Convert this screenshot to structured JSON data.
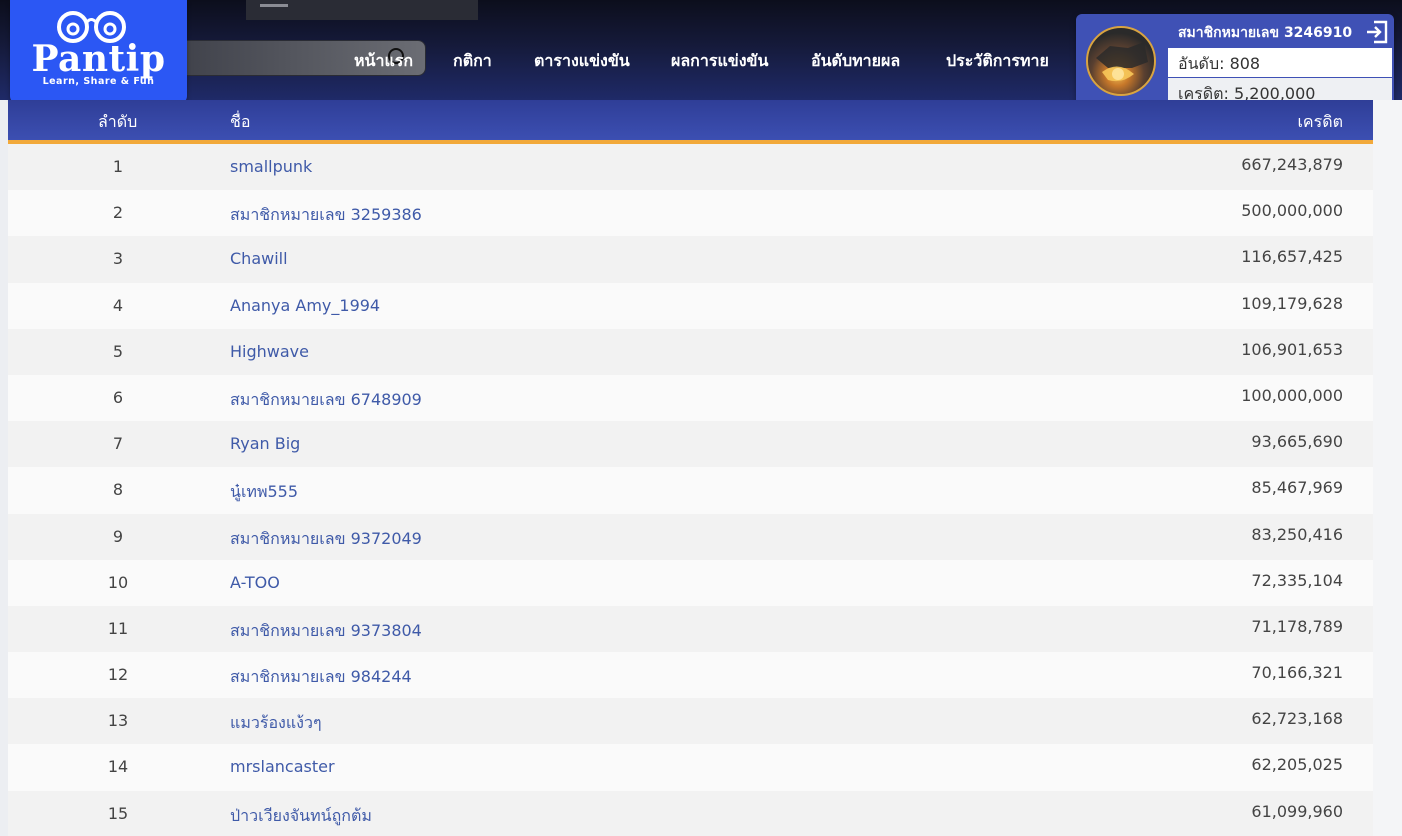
{
  "logo": {
    "text": "Pantip",
    "tagline": "Learn, Share & Fun"
  },
  "nav": [
    {
      "label": "หน้าแรก"
    },
    {
      "label": "กติกา"
    },
    {
      "label": "ตารางแข่งขัน"
    },
    {
      "label": "ผลการแข่งขัน"
    },
    {
      "label": "อันดับทายผล"
    },
    {
      "label": "ประวัติการทาย"
    }
  ],
  "user": {
    "name": "สมาชิกหมายเลข 3246910",
    "rank": "อันดับ: 808",
    "credit": "เครดิต: 5,200,000"
  },
  "table": {
    "headers": {
      "rank": "ลำดับ",
      "name": "ชื่อ",
      "credit": "เครดิต"
    },
    "rows": [
      {
        "rank": "1",
        "name": "smallpunk",
        "credit": "667,243,879"
      },
      {
        "rank": "2",
        "name": "สมาชิกหมายเลข 3259386",
        "credit": "500,000,000"
      },
      {
        "rank": "3",
        "name": "Chawill",
        "credit": "116,657,425"
      },
      {
        "rank": "4",
        "name": "Ananya Amy_1994",
        "credit": "109,179,628"
      },
      {
        "rank": "5",
        "name": "Highwave",
        "credit": "106,901,653"
      },
      {
        "rank": "6",
        "name": "สมาชิกหมายเลข 6748909",
        "credit": "100,000,000"
      },
      {
        "rank": "7",
        "name": "Ryan Big",
        "credit": "93,665,690"
      },
      {
        "rank": "8",
        "name": "นู๋เทพ555",
        "credit": "85,467,969"
      },
      {
        "rank": "9",
        "name": "สมาชิกหมายเลข 9372049",
        "credit": "83,250,416"
      },
      {
        "rank": "10",
        "name": "A-TOO",
        "credit": "72,335,104"
      },
      {
        "rank": "11",
        "name": "สมาชิกหมายเลข 9373804",
        "credit": "71,178,789"
      },
      {
        "rank": "12",
        "name": "สมาชิกหมายเลข 984244",
        "credit": "70,166,321"
      },
      {
        "rank": "13",
        "name": "แมวร้องแง้วๆ",
        "credit": "62,723,168"
      },
      {
        "rank": "14",
        "name": "mrslancaster",
        "credit": "62,205,025"
      },
      {
        "rank": "15",
        "name": "ป่าวเวียงจันทน์ถูกต้ม",
        "credit": "61,099,960"
      }
    ]
  }
}
